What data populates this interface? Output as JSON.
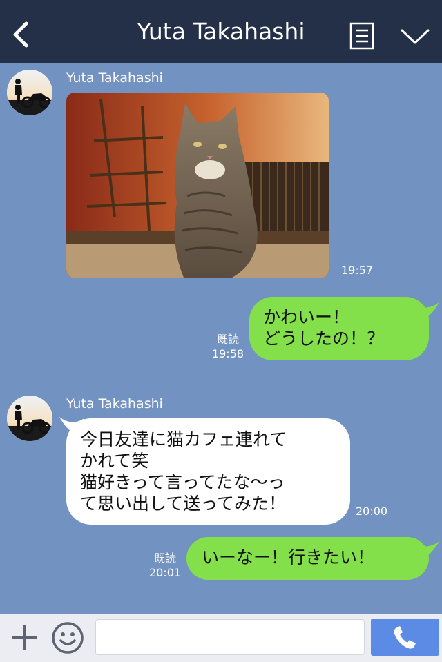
{
  "header": {
    "title": "Yuta Takahashi",
    "back_icon": "chevron-left-icon",
    "notes_icon": "notes-icon",
    "menu_icon": "chevron-down-icon",
    "bg_color": "#243048"
  },
  "chat": {
    "bg_color": "#7293c1",
    "incoming_bg": "#ffffff",
    "outgoing_bg": "#84e04a",
    "messages": [
      {
        "sender": "Yuta Takahashi",
        "type": "image",
        "image": "tabby-cat-in-cafe",
        "time": "19:57"
      },
      {
        "direction": "outgoing",
        "read": "既読",
        "time": "19:58",
        "lines": [
          "かわいー！",
          "どうしたの！？"
        ]
      },
      {
        "sender": "Yuta Takahashi",
        "type": "text",
        "time": "20:00",
        "lines": [
          "今日友達に猫カフェ連れて",
          "かれて笑",
          "猫好きって言ってたな〜っ",
          "て思い出して送ってみた！"
        ]
      },
      {
        "direction": "outgoing",
        "read": "既読",
        "time": "20:01",
        "lines": [
          "いーなー！行きたい！"
        ]
      }
    ]
  },
  "composer": {
    "input_value": "",
    "plus_icon": "plus-icon",
    "emoji_icon": "smiley-icon",
    "call_icon": "phone-icon",
    "call_color": "#5b8be4"
  }
}
